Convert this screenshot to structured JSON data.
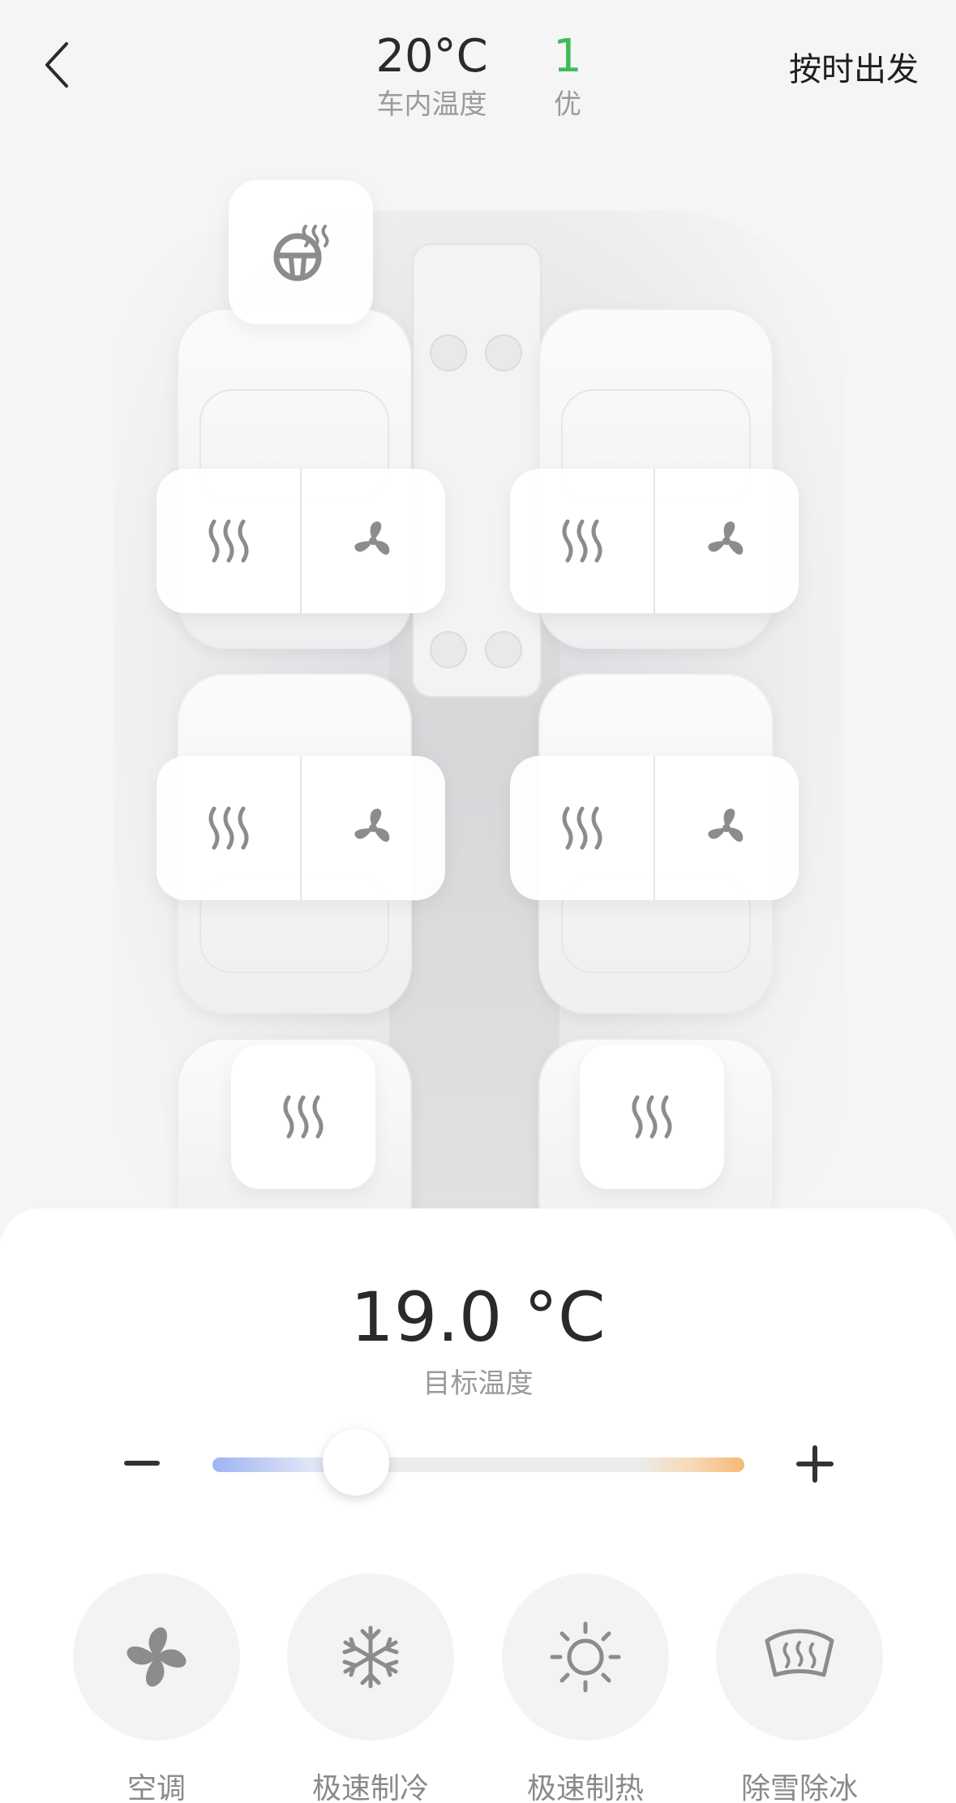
{
  "header": {
    "cabin_temp": "20°C",
    "cabin_temp_label": "车内温度",
    "air_quality_value": "1",
    "air_quality_label": "优",
    "scheduled_depart": "按时出发"
  },
  "climate": {
    "target_temp": "19.0 °C",
    "target_label": "目标温度",
    "slider_level": 0.27
  },
  "modes": [
    {
      "label": "空调",
      "icon": "fan-icon"
    },
    {
      "label": "极速制冷",
      "icon": "snowflake-icon"
    },
    {
      "label": "极速制热",
      "icon": "sun-icon"
    },
    {
      "label": "除雪除冰",
      "icon": "defrost-icon"
    }
  ],
  "seat_controls": {
    "steering_wheel": "steering-heat-icon",
    "front_left": [
      "seat-heat-icon",
      "seat-vent-icon"
    ],
    "front_right": [
      "seat-heat-icon",
      "seat-vent-icon"
    ],
    "second_left": [
      "seat-heat-icon",
      "seat-vent-icon"
    ],
    "second_right": [
      "seat-heat-icon",
      "seat-vent-icon"
    ],
    "third_left": "seat-heat-icon",
    "third_right": "seat-heat-icon"
  },
  "colors": {
    "good_air": "#3dbb57",
    "cool": "#9db4f3",
    "warm": "#f5b977",
    "icon": "#8c8c8c"
  }
}
